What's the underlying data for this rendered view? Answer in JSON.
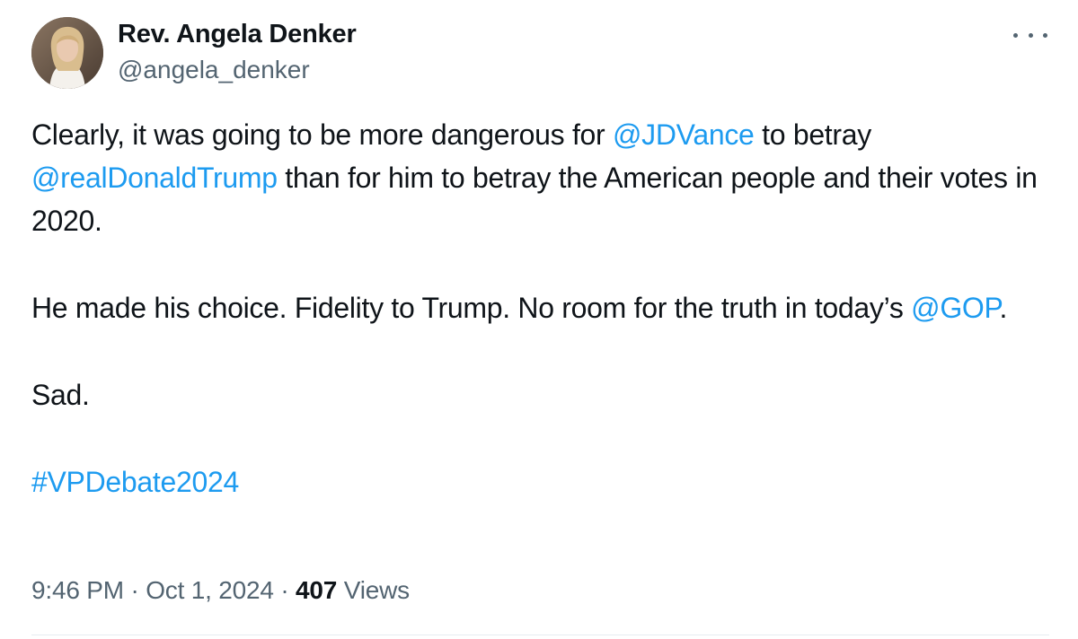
{
  "author": {
    "display_name": "Rev. Angela Denker",
    "handle": "@angela_denker"
  },
  "menu": {
    "icon": "more-horizontal-icon"
  },
  "tweet": {
    "p1_text1": "Clearly, it was going to be more dangerous for ",
    "p1_mention1": "@JDVance",
    "p1_text2": " to betray ",
    "p1_mention2": "@realDonaldTrump",
    "p1_text3": " than for him to betray the American people and their votes in 2020.",
    "p2_text1": "He made his choice. Fidelity to Trump. No room for the truth in today’s ",
    "p2_mention": "@GOP",
    "p2_text2": ".",
    "p3_text": "Sad.",
    "hashtag": "#VPDebate2024"
  },
  "meta": {
    "time": "9:46 PM",
    "sep1": " · ",
    "date": "Oct 1, 2024",
    "sep2": " · ",
    "views_count": "407",
    "views_label": " Views"
  },
  "colors": {
    "link": "#1d9bf0",
    "secondary_text": "#536471",
    "primary_text": "#0f1419"
  }
}
